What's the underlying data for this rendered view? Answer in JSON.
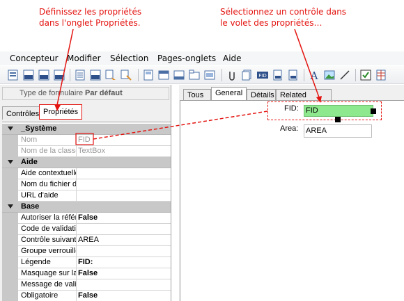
{
  "callouts": {
    "left_line1": "Définissez les propriétés",
    "left_line2": "dans l'onglet Propriétés.",
    "right_line1": "Sélectionnez un contrôle dans",
    "right_line2": "le volet des propriétés…"
  },
  "menu": {
    "items": [
      "Concepteur",
      "Modifier",
      "Sélection",
      "Pages-onglets",
      "Aide"
    ]
  },
  "form_type": {
    "label": "Type de formulaire",
    "value": "Par défaut"
  },
  "left_tabs": {
    "controles": "Contrôles",
    "proprietes": "Propriétés"
  },
  "right_tabs": {
    "tous": "Tous",
    "general": "General",
    "details": "Détails",
    "related": "Related tables"
  },
  "properties": {
    "systeme": {
      "name": "_Système"
    },
    "nom": {
      "name": "Nom",
      "value": "FID"
    },
    "nom_classe": {
      "name": "Nom de la classe",
      "value": "TextBox"
    },
    "aide": {
      "name": "Aide"
    },
    "aide_contextuelle": {
      "name": "Aide contextuelle",
      "value": ""
    },
    "nom_fichier": {
      "name": "Nom du fichier d",
      "value": ""
    },
    "url_aide": {
      "name": "URL d'aide",
      "value": ""
    },
    "base": {
      "name": "Base"
    },
    "autoriser": {
      "name": "Autoriser la référ",
      "value": "False"
    },
    "code_validation": {
      "name": "Code de validati",
      "value": ""
    },
    "controle_suivant": {
      "name": "Contrôle suivant",
      "value": "AREA"
    },
    "groupe": {
      "name": "Groupe verrouille",
      "value": ""
    },
    "legende": {
      "name": "Légende",
      "value": "FID:"
    },
    "masquage": {
      "name": "Masquage sur la",
      "value": "False"
    },
    "message": {
      "name": "Message de vali",
      "value": ""
    },
    "obligatoire": {
      "name": "Obligatoire",
      "value": "False"
    }
  },
  "form": {
    "fid_label": "FID:",
    "fid_value": "FID",
    "area_label": "Area:",
    "area_value": "AREA"
  },
  "colors": {
    "callout": "#e3130f",
    "selected_field": "#8ee88e"
  }
}
